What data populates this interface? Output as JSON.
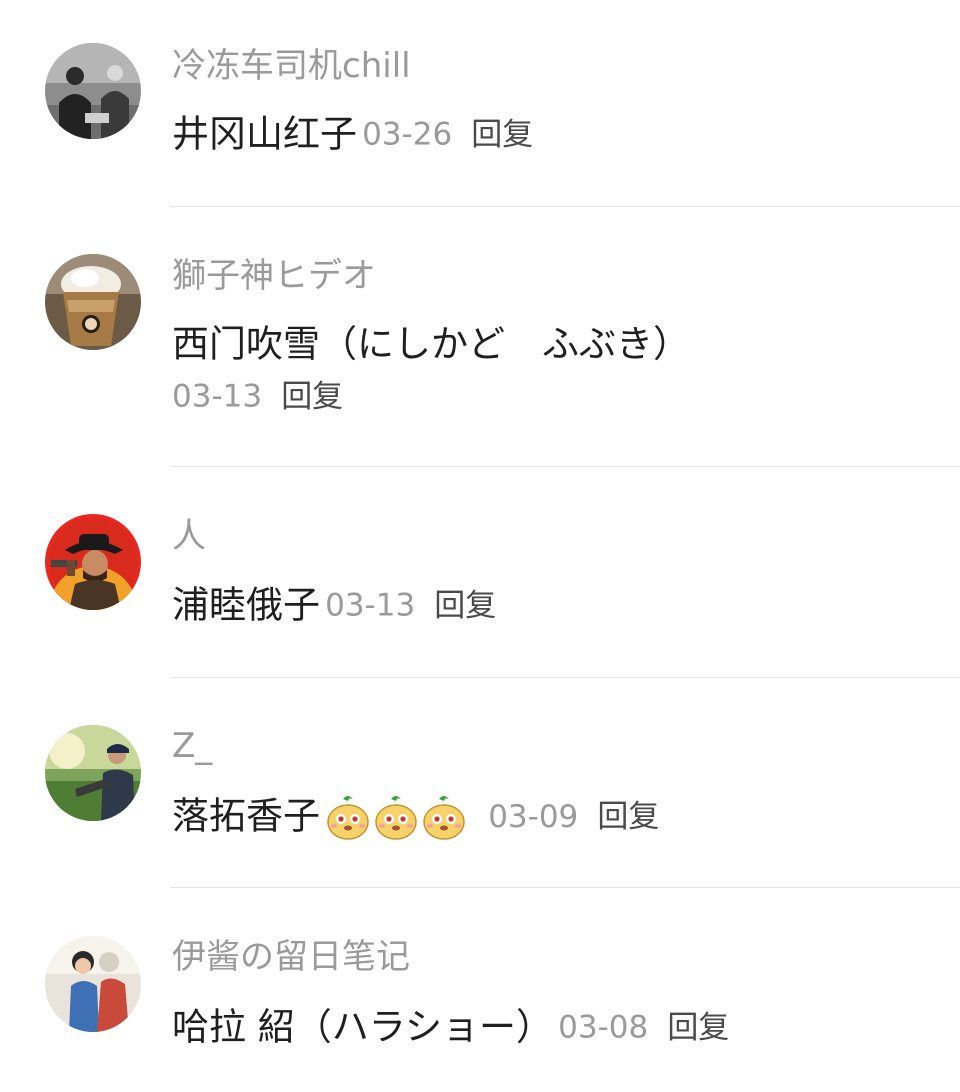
{
  "comments": [
    {
      "username": "冷冻车司机chill",
      "text": "井冈山红子",
      "date": "03-26",
      "reply_label": "回复",
      "avatar_icon": "avatar-photo-two-men"
    },
    {
      "username": "獅子神ヒデオ",
      "text": "西门吹雪（にしかど　ふぶき）",
      "date": "03-13",
      "reply_label": "回复",
      "avatar_icon": "avatar-photo-iced-coffee"
    },
    {
      "username": "人",
      "text": "浦睦俄子",
      "date": "03-13",
      "reply_label": "回复",
      "avatar_icon": "avatar-cowboy-gunslinger"
    },
    {
      "username": "Z_",
      "text": "落拓香子",
      "date": "03-09",
      "reply_label": "回复",
      "avatar_icon": "avatar-photo-man-outdoors",
      "emojis": [
        "peach-face-emoji",
        "peach-face-emoji",
        "peach-face-emoji"
      ]
    },
    {
      "username": "伊酱の留日笔记",
      "text": "哈拉 紹（ハラショー）",
      "date": "03-08",
      "reply_label": "回复",
      "avatar_icon": "avatar-photo-child"
    }
  ]
}
